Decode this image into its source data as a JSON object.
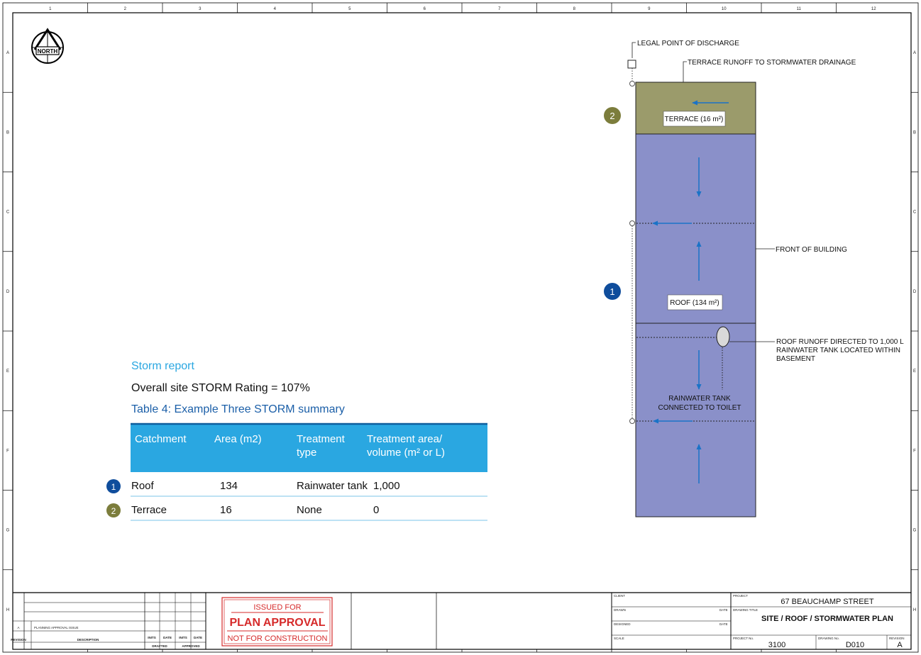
{
  "grid": {
    "columns": [
      "1",
      "2",
      "3",
      "4",
      "5",
      "6",
      "7",
      "8",
      "9",
      "10",
      "11",
      "12"
    ],
    "rows": [
      "A",
      "B",
      "C",
      "D",
      "E",
      "F",
      "G",
      "H"
    ]
  },
  "north": {
    "label": "NORTH"
  },
  "annotations": {
    "legal_point": "LEGAL POINT OF DISCHARGE",
    "terrace_runoff": "TERRACE RUNOFF TO STORMWATER DRAINAGE",
    "front_of_building": "FRONT OF BUILDING",
    "roof_runoff_line1": "ROOF RUNOFF DIRECTED TO 1,000 L",
    "roof_runoff_line2": "RAINWATER TANK LOCATED WITHIN",
    "roof_runoff_line3": "BASEMENT",
    "tank_line1": "RAINWATER TANK",
    "tank_line2": "CONNECTED TO TOILET"
  },
  "areas": {
    "terrace_label": "TERRACE (16 m²)",
    "roof_label": "ROOF (134 m²)",
    "terrace_marker": "2",
    "roof_marker": "1",
    "terrace_color": "#9b9b6b",
    "roof_color": "#8a90c9"
  },
  "report": {
    "heading": "Storm report",
    "rating": "Overall site STORM Rating = 107%",
    "table_title": "Table 4: Example Three STORM summary",
    "headers": [
      "Catchment",
      "Area (m2)",
      "Treatment type",
      "Treatment area/ volume (m² or L)"
    ],
    "header_lines": [
      [
        "Catchment"
      ],
      [
        "Area (m2)"
      ],
      [
        "Treatment",
        "type"
      ],
      [
        "Treatment area/",
        "volume (m² or L)"
      ]
    ],
    "rows": [
      {
        "marker": "1",
        "marker_color": "#0f4d9c",
        "cells": [
          "Roof",
          "134",
          "Rainwater tank",
          "1,000"
        ]
      },
      {
        "marker": "2",
        "marker_color": "#7c7d3c",
        "cells": [
          "Terrace",
          "16",
          "None",
          "0"
        ]
      }
    ],
    "header_color": "#2aa7e1"
  },
  "title_block": {
    "revision_code": "A",
    "revision_desc": "PLANNING APPROVAL ISSUE",
    "col_revision": "REVISION",
    "col_description": "DESCRIPTION",
    "col_inits": "INITS",
    "col_date": "DATE",
    "drafted": "DRAFTED",
    "approved": "APPROVED",
    "stamp_line1": "ISSUED FOR",
    "stamp_line2": "PLAN APPROVAL",
    "stamp_line3": "NOT FOR CONSTRUCTION",
    "client_label": "CLIENT",
    "drawn_label": "DRAWN",
    "designed_label": "DESIGNED",
    "scale_label": "SCALE",
    "date_label": "DATE",
    "project_label": "PROJECT",
    "project": "67 BEAUCHAMP STREET",
    "drawing_title_label": "DRAWING TITLE",
    "drawing_title": "SITE / ROOF / STORMWATER PLAN",
    "project_no_label": "PROJECT No.",
    "project_no": "3100",
    "drawing_no_label": "DRAWING No.",
    "drawing_no": "D010",
    "revision_label": "REVISION",
    "revision": "A"
  }
}
